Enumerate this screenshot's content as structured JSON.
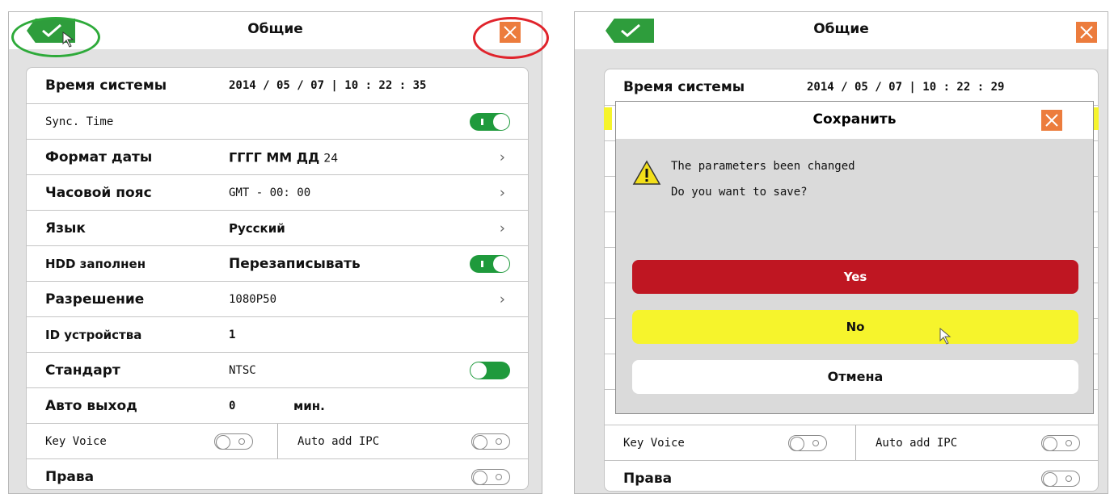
{
  "left": {
    "title": "Общие",
    "rows": {
      "system_time": {
        "label": "Время системы",
        "value": "2014 / 05 / 07 | 10 : 22 : 35"
      },
      "sync": {
        "label": "Sync. Time"
      },
      "date_format": {
        "label": "Формат даты",
        "value_main": "ГГГГ ММ ДД",
        "value_suffix": "24"
      },
      "timezone": {
        "label": "Часовой пояс",
        "value": "GMT - 00: 00"
      },
      "language": {
        "label": "Язык",
        "value": "Русский"
      },
      "hdd_full": {
        "label": "HDD заполнен",
        "value": "Перезаписывать"
      },
      "resolution": {
        "label": "Разрешение",
        "value": "1080P50"
      },
      "device_id": {
        "label": "ID устройства",
        "value": "1"
      },
      "standard": {
        "label": "Стандарт",
        "value": "NTSC"
      },
      "auto_exit": {
        "label": "Авто выход",
        "value": "0",
        "unit": "мин."
      },
      "key_voice": {
        "label": "Key Voice"
      },
      "auto_add_ipc": {
        "label": "Auto add IPC"
      },
      "rights": {
        "label": "Права"
      }
    }
  },
  "right": {
    "title": "Общие",
    "rows": {
      "system_time": {
        "label": "Время системы",
        "value": "2014 / 05 / 07 | 10 : 22 : 29"
      },
      "key_voice": {
        "label": "Key Voice"
      },
      "auto_add_ipc": {
        "label": "Auto add IPC"
      },
      "rights": {
        "label": "Права"
      }
    },
    "dialog": {
      "title": "Сохранить",
      "message_line1": "The parameters been changed",
      "message_line2": "Do you want to save?",
      "yes_label": "Yes",
      "no_label": "No",
      "cancel_label": "Отмена"
    }
  },
  "colors": {
    "ok_green": "#2e9d3c",
    "close_orange": "#ec7c3d",
    "toggle_green": "#1f9a3c",
    "yes_red": "#bf1622",
    "no_yellow": "#f6f42c",
    "highlight_green_ring": "#2eaa3a",
    "highlight_red_ring": "#e0242c"
  },
  "icons": [
    "check-icon",
    "close-icon",
    "chevron-right-icon",
    "warning-icon",
    "cursor-icon"
  ]
}
